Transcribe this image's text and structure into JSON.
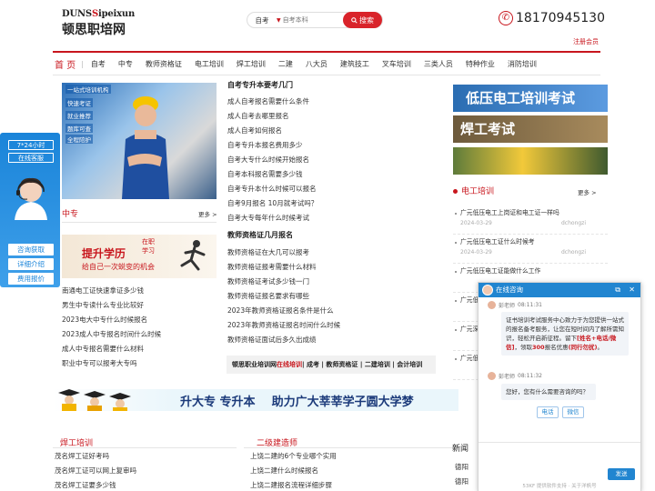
{
  "header": {
    "logo_en_a": "DUNS",
    "logo_en_b": "ipeixun",
    "logo_cn": "顿思职培网",
    "search_category": "自考",
    "search_placeholder": "自考本科",
    "search_button": "搜索",
    "phone": "18170945130",
    "register_login": "注册会员"
  },
  "nav": {
    "home": "首 页",
    "items": [
      "自考",
      "中专",
      "教师资格证",
      "电工培训",
      "焊工培训",
      "二建",
      "八大员",
      "建筑技工",
      "叉车培训",
      "三类人员",
      "特种作业",
      "消防培训"
    ]
  },
  "left": {
    "photo_tags": [
      "一站式培训机构",
      "快速考证",
      "就业推荐",
      "题库可查",
      "全程陪护"
    ],
    "zz_title": "中专",
    "zz_more": "更多 >",
    "banner_t1": "提升学历",
    "banner_t2": "给自己一次蜕变的机会",
    "banner_t3": "在职\n学习",
    "zz_list": [
      "南通电工证快速拿证多少钱",
      "男生中专读什么专业比较好",
      "2023电大中专什么时候报名",
      "2023成人中专报名时间什么时候",
      "成人中专报名需要什么材料",
      "职业中专可以报考大专吗"
    ]
  },
  "mid": {
    "title1": "自考专升本要考几门",
    "list1": [
      "成人自考报名需要什么条件",
      "成人自考去哪里报名",
      "成人自考如何报名",
      "自考专升本报名费用多少",
      "自考大专什么时候开始报名",
      "自考本科报名需要多少钱",
      "自考专升本什么时候可以报名",
      "自考9月报名 10月就考试吗？",
      "自考大专每年什么时候考试"
    ],
    "title2": "教师资格证几月报名",
    "list2": [
      "教师资格证在大几可以报考",
      "教师资格证报考需要什么材料",
      "教师资格证考试多少钱一门",
      "教师资格证报名要求有哪些",
      "2023年教师资格证报名条件是什么",
      "2023年教师资格证报名时间什么时候",
      "教师资格证面试后多久出成绩"
    ],
    "links": {
      "a": "顿思职业培训网",
      "b": "在线培训",
      "c": " | 成考 | 教师资格证 | 二建培训 | 会计培训"
    }
  },
  "right": {
    "banner1": "低压电工培训考试",
    "banner2": "焊工考试",
    "dg_title": "电工培训",
    "dg_more": "更多 >",
    "dg_list": [
      {
        "title": "广元低压电工上岗证和电工证一样吗",
        "date": "2024-03-29",
        "author": "dchongzi"
      },
      {
        "title": "广元低压电工证什么时候考",
        "date": "2024-03-29",
        "author": "dchongzi"
      },
      {
        "title": "广元低压电工证能做什么工作",
        "date": "",
        "author": ""
      },
      {
        "title": "广元低",
        "date": "",
        "author": ""
      },
      {
        "title": "广元深",
        "date": "",
        "author": ""
      },
      {
        "title": "广元低",
        "date": "",
        "author": ""
      }
    ]
  },
  "sidebar": {
    "tag1": "7*24小时",
    "tag2": "在线客服",
    "btn1": "咨询获取",
    "btn2": "详细介绍",
    "btn3": "费用报价"
  },
  "promo": {
    "text": "升大专 专升本    助力广大莘莘学子圆大学梦"
  },
  "bottom": {
    "wg_title": "焊工培训",
    "wg_list": [
      "茂名焊工证好考吗",
      "茂名焊工证可以网上复审吗",
      "茂名焊工证要多少钱"
    ],
    "ej_title": "二级建造师",
    "ej_list": [
      "上饶二建的6个专业哪个实用",
      "上饶二建什么时候报名",
      "上饶二建报名流程详细步骤"
    ],
    "xw_title": "新闻",
    "xw_list": [
      "德阳",
      "德阳"
    ]
  },
  "chat": {
    "title": "在线咨询",
    "agent1": "彭老师",
    "time1": "08:11:31",
    "msg1_a": "证书培训考试服务中心致力于为您提供一站式的报名备考服务，让您在短时间内了解所需知识，轻松开启新征程。留下",
    "msg1_b": "[姓名+电话/微信]",
    "msg1_c": "，领取",
    "msg1_d": "300",
    "msg1_e": "报名优惠",
    "msg1_f": "(同行勿扰)",
    "msg1_g": "。",
    "agent2": "彭老师",
    "time2": "08:11:32",
    "msg2": "您好，您有什么需要咨询的吗？",
    "opt1": "电话",
    "opt2": "微信",
    "send": "发送",
    "footer": "53KF 提供软件支持 · 关于洋帆号"
  }
}
